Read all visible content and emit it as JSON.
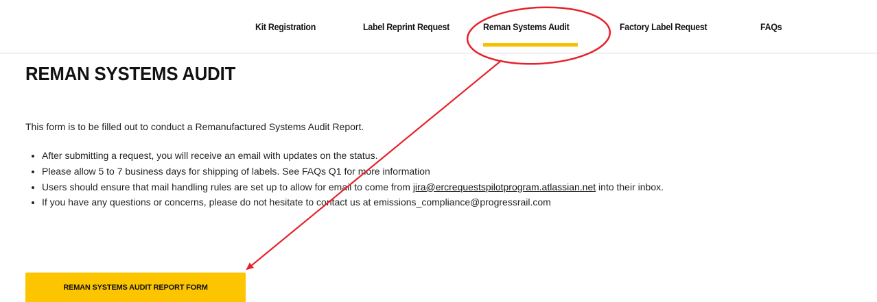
{
  "nav": {
    "items": [
      {
        "label": "Kit Registration"
      },
      {
        "label": "Label Reprint Request"
      },
      {
        "label": "Reman Systems Audit"
      },
      {
        "label": "Factory Label Request"
      },
      {
        "label": "FAQs"
      }
    ],
    "active": "Reman Systems Audit",
    "active_color": "#f7c000"
  },
  "page": {
    "title": "REMAN SYSTEMS AUDIT",
    "intro": "This form is to be filled out to conduct a Remanufactured Systems Audit Report.",
    "bullets": [
      "After submitting a request, you will receive an email with updates on the status.",
      "Please allow 5 to 7 business days for shipping of labels. See FAQs Q1 for more information",
      {
        "before": "Users should ensure that mail handling rules are set up to allow for email to come from ",
        "link": "jira@ercrequestspilotprogram.atlassian.net",
        "after": " into their inbox."
      },
      "If you have any questions or concerns, please do not hesitate to contact us at emissions_compliance@progressrail.com"
    ]
  },
  "cta": {
    "label": "REMAN SYSTEMS AUDIT REPORT FORM",
    "color": "#fdc400"
  },
  "annotation": {
    "color": "#e8202a"
  }
}
